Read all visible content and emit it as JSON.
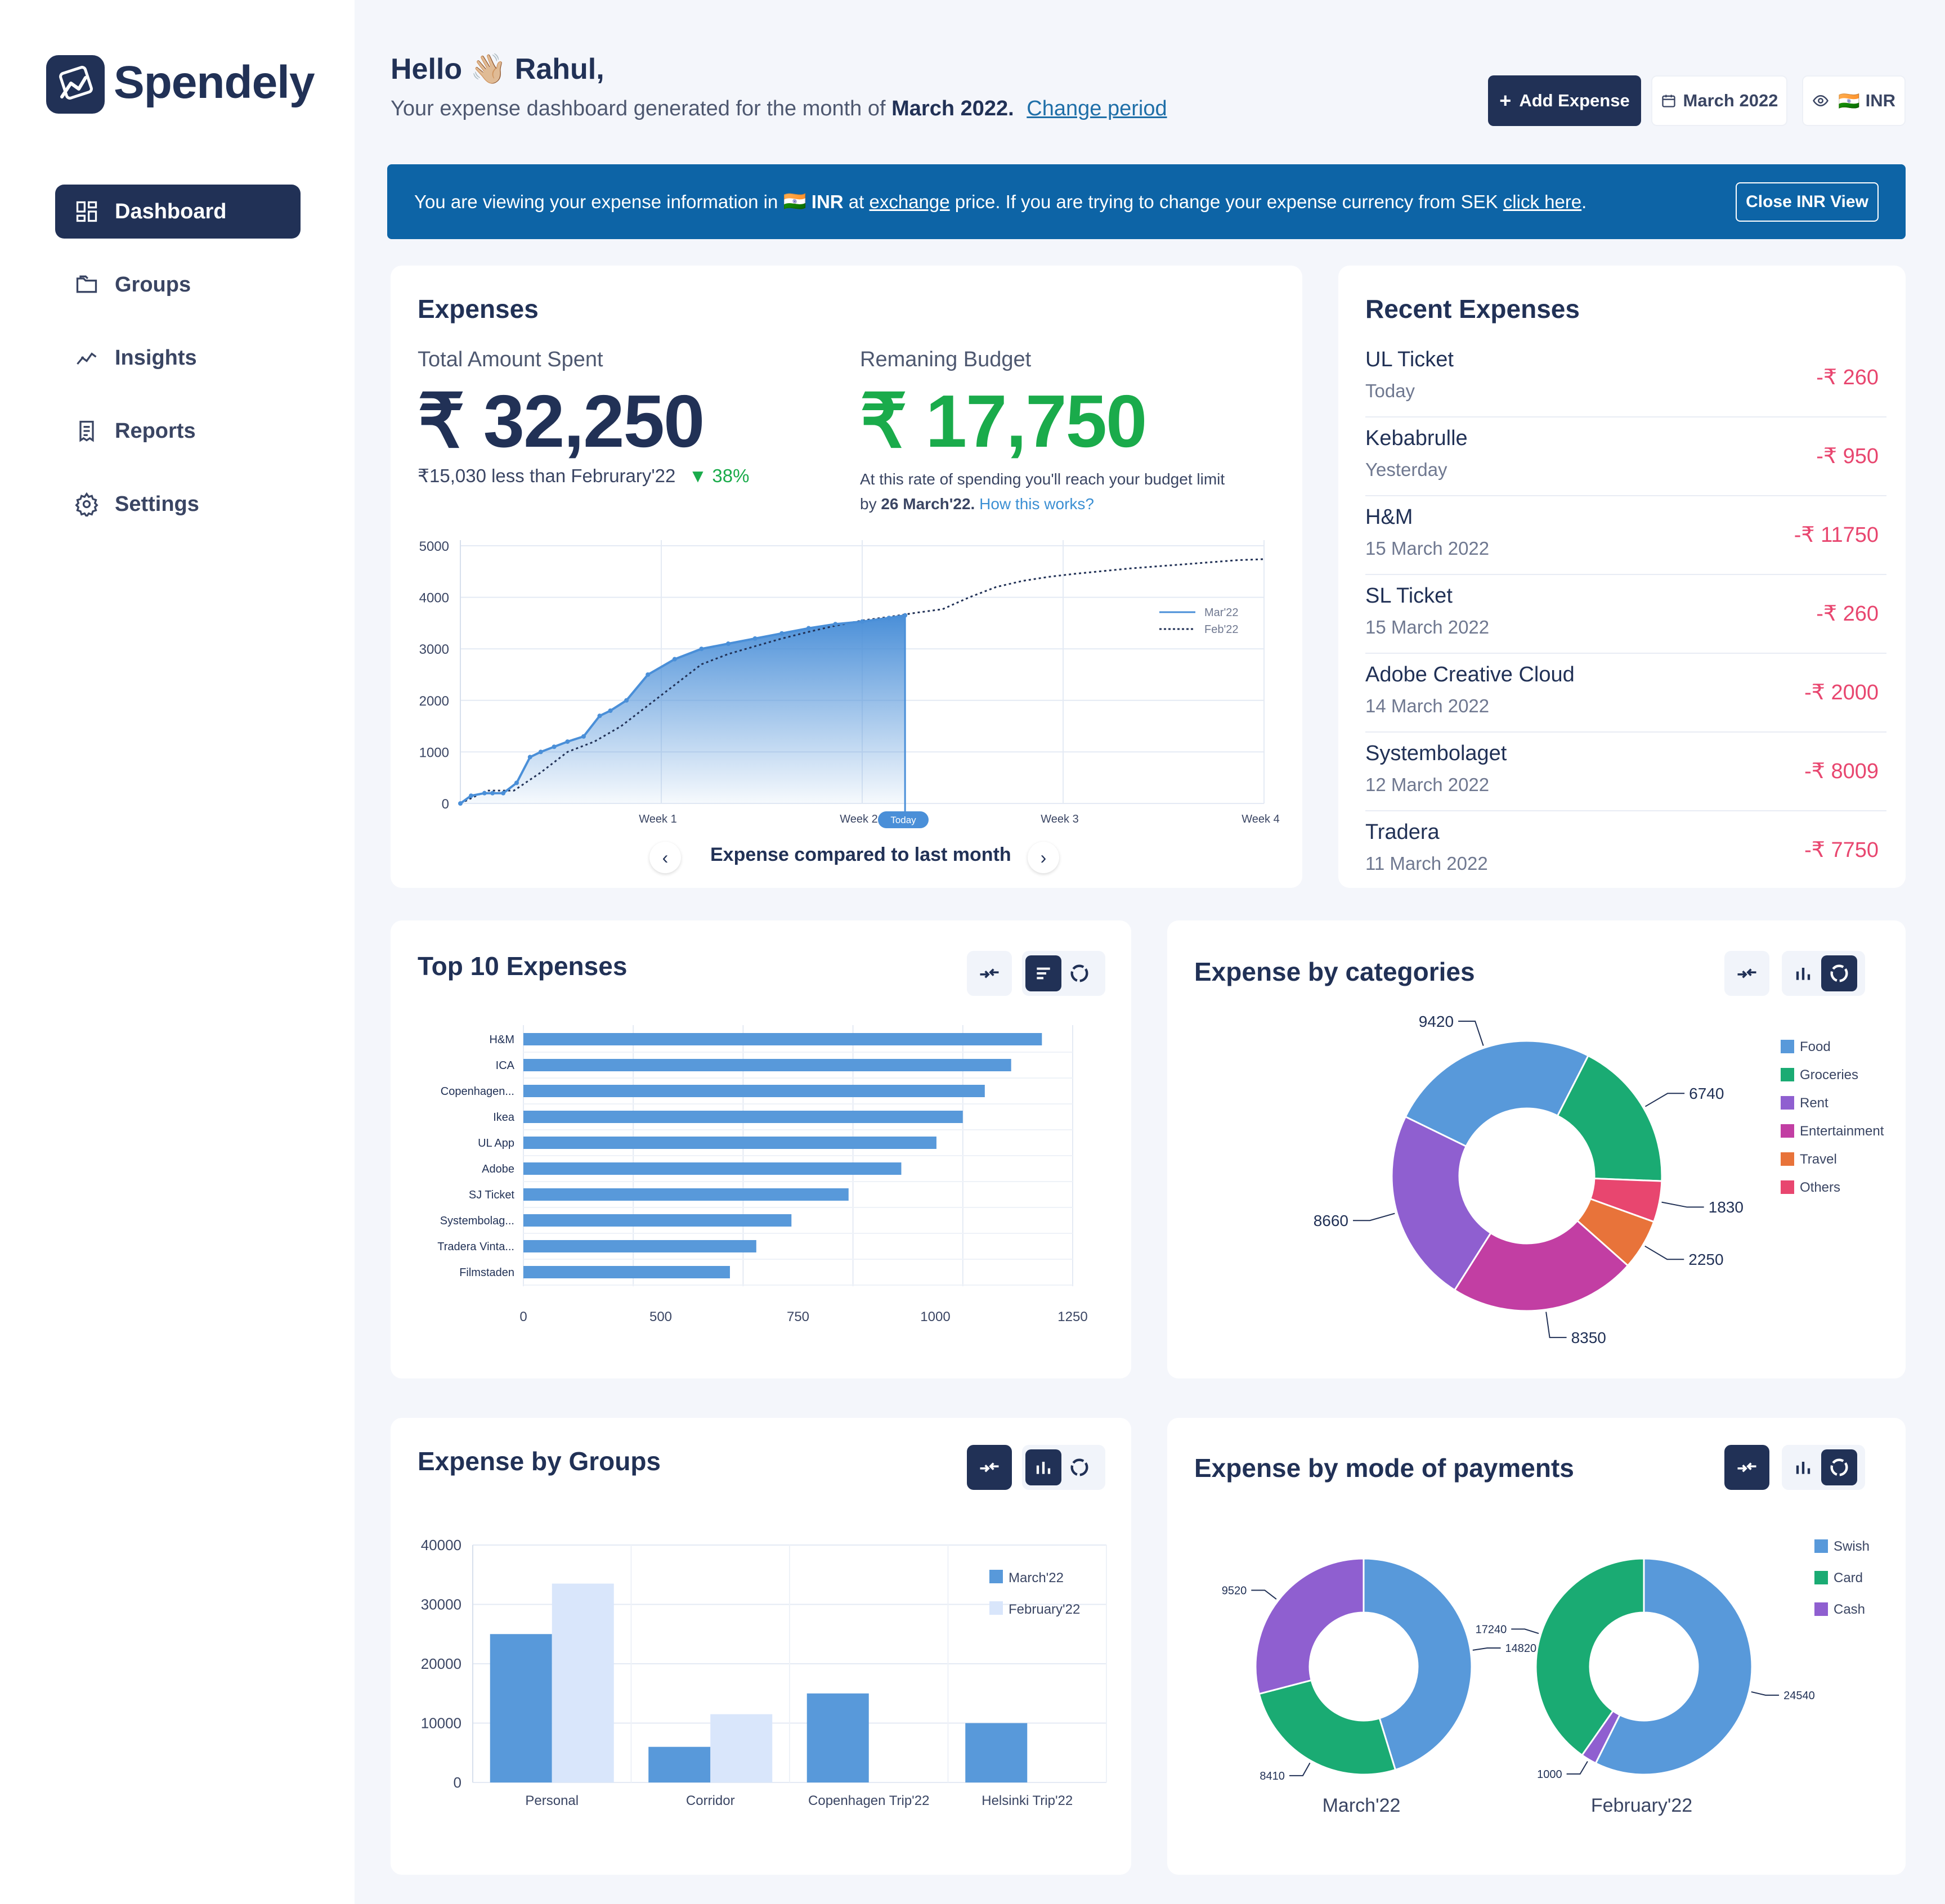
{
  "app": {
    "name": "Spendely"
  },
  "sidebar": {
    "items": [
      {
        "label": "Dashboard",
        "icon": "dashboard-icon",
        "active": true
      },
      {
        "label": "Groups",
        "icon": "folder-icon"
      },
      {
        "label": "Insights",
        "icon": "trend-icon"
      },
      {
        "label": "Reports",
        "icon": "receipt-icon"
      },
      {
        "label": "Settings",
        "icon": "gear-icon"
      }
    ]
  },
  "header": {
    "greeting_prefix": "Hello",
    "greeting_emoji": "👋🏼",
    "greeting_name": "Rahul,",
    "subtitle_prefix": "Your expense dashboard generated for the month of",
    "subtitle_period": "March 2022.",
    "change_period": "Change period",
    "add_expense": "Add Expense",
    "month": "March 2022",
    "currency_flag": "🇮🇳",
    "currency": "INR"
  },
  "banner": {
    "t1": "You are viewing your expense information in",
    "flag": "🇮🇳",
    "currency": "INR",
    "t2": "at",
    "link1": "exchange",
    "t3": "price. If you are trying to change your expense currency from SEK",
    "link2": "click here",
    "t4": ".",
    "close": "Close INR View"
  },
  "expenses": {
    "title": "Expenses",
    "total_label": "Total Amount Spent",
    "total_value": "₹ 32,250",
    "compare_text": "₹15,030 less than Februrary'22",
    "compare_pct": "▼ 38%",
    "budget_label": "Remaning Budget",
    "budget_value": "₹ 17,750",
    "rate_text_1": "At this rate of spending you'll reach your budget limit",
    "rate_text_2a": "by",
    "rate_text_2b": "26 March'22.",
    "how_link": "How this works?",
    "footer": "Expense compared to last month",
    "today": "Today"
  },
  "recent": {
    "title": "Recent Expenses",
    "items": [
      {
        "name": "UL Ticket",
        "date": "Today",
        "amount": "-₹ 260"
      },
      {
        "name": "Kebabrulle",
        "date": "Yesterday",
        "amount": "-₹ 950"
      },
      {
        "name": "H&M",
        "date": "15 March 2022",
        "amount": "-₹ 11750"
      },
      {
        "name": "SL Ticket",
        "date": "15 March 2022",
        "amount": "-₹ 260"
      },
      {
        "name": "Adobe Creative Cloud",
        "date": "14 March 2022",
        "amount": "-₹ 2000"
      },
      {
        "name": "Systembolaget",
        "date": "12 March 2022",
        "amount": "-₹ 8009"
      },
      {
        "name": "Tradera",
        "date": "11 March 2022",
        "amount": "-₹ 7750"
      }
    ]
  },
  "top10": {
    "title": "Top 10 Expenses"
  },
  "categories": {
    "title": "Expense by categories"
  },
  "groups": {
    "title": "Expense by Groups"
  },
  "payments": {
    "title": "Expense by mode of payments"
  },
  "colors": {
    "navy": "#213156",
    "blue": "#5899da",
    "light_blue": "#d9e6fb",
    "green": "#1aab73",
    "purple": "#8f5fd0",
    "magenta": "#c23ea3",
    "orange": "#e8733a",
    "pink": "#e8466f",
    "banner": "#0d64a6"
  },
  "chart_data": [
    {
      "type": "line",
      "id": "cumulative",
      "x_ticks": [
        "Week 1",
        "Week 2",
        "Week 3",
        "Week 4"
      ],
      "ylim": [
        0,
        5000
      ],
      "y_ticks": [
        0,
        1000,
        2000,
        3000,
        4000,
        5000
      ],
      "series": [
        {
          "name": "Mar'22",
          "x": [
            0,
            0.4,
            0.9,
            1.2,
            1.6,
            2.1,
            2.6,
            3.0,
            3.5,
            4.0,
            4.6,
            5.2,
            5.6,
            6.2,
            7.0,
            8.0,
            9.0,
            10.0,
            11.0,
            12.0,
            13.0,
            14.0,
            15.0,
            16.0,
            16.6
          ],
          "y": [
            0,
            150,
            200,
            200,
            200,
            400,
            900,
            1000,
            1100,
            1200,
            1300,
            1700,
            1800,
            2000,
            2500,
            2800,
            3000,
            3100,
            3200,
            3300,
            3400,
            3480,
            3530,
            3600,
            3650
          ]
        },
        {
          "name": "Feb'22",
          "x": [
            0,
            1,
            2,
            3,
            4,
            5,
            6,
            7,
            8,
            9,
            10,
            11,
            12,
            13,
            14,
            15,
            16,
            17,
            18,
            19,
            20,
            21,
            22,
            23,
            24,
            25,
            26,
            27,
            28,
            29,
            30
          ],
          "y": [
            0,
            250,
            250,
            600,
            1000,
            1200,
            1500,
            1900,
            2300,
            2700,
            2900,
            3050,
            3200,
            3330,
            3450,
            3550,
            3620,
            3700,
            3770,
            4000,
            4200,
            4320,
            4400,
            4460,
            4510,
            4560,
            4600,
            4640,
            4680,
            4720,
            4740
          ]
        }
      ]
    },
    {
      "type": "bar",
      "id": "top10",
      "orientation": "horizontal",
      "categories": [
        "H&M",
        "ICA",
        "Copenhagen...",
        "Ikea",
        "UL App",
        "Adobe",
        "SJ Ticket",
        "Systembolag...",
        "Tradera Vinta...",
        "Filmstaden"
      ],
      "values": [
        1180,
        1110,
        1050,
        1000,
        940,
        860,
        740,
        610,
        530,
        470
      ],
      "x_ticks": [
        0,
        500,
        750,
        1000,
        1250
      ]
    },
    {
      "type": "pie",
      "id": "categories",
      "categories": [
        "Food",
        "Groceries",
        "Rent",
        "Entertainment",
        "Travel",
        "Others"
      ],
      "values": [
        9420,
        6740,
        8660,
        8350,
        2250,
        1830
      ]
    },
    {
      "type": "bar",
      "id": "groups",
      "categories": [
        "Personal",
        "Corridor",
        "Copenhagen Trip'22",
        "Helsinki Trip'22"
      ],
      "series": [
        {
          "name": "March'22",
          "values": [
            25000,
            6000,
            15000,
            10000
          ]
        },
        {
          "name": "February'22",
          "values": [
            33500,
            11500,
            0,
            0
          ]
        }
      ],
      "ylim": [
        0,
        40000
      ],
      "y_ticks": [
        0,
        10000,
        20000,
        30000,
        40000
      ]
    },
    {
      "type": "pie",
      "id": "payments",
      "legend": [
        "Swish",
        "Card",
        "Cash"
      ],
      "charts": [
        {
          "title": "March'22",
          "categories": [
            "Swish",
            "Card",
            "Cash"
          ],
          "values": [
            14820,
            8410,
            9520
          ]
        },
        {
          "title": "February'22",
          "categories": [
            "Swish",
            "Cash",
            "Card"
          ],
          "values": [
            24540,
            1000,
            17240
          ]
        }
      ]
    }
  ]
}
